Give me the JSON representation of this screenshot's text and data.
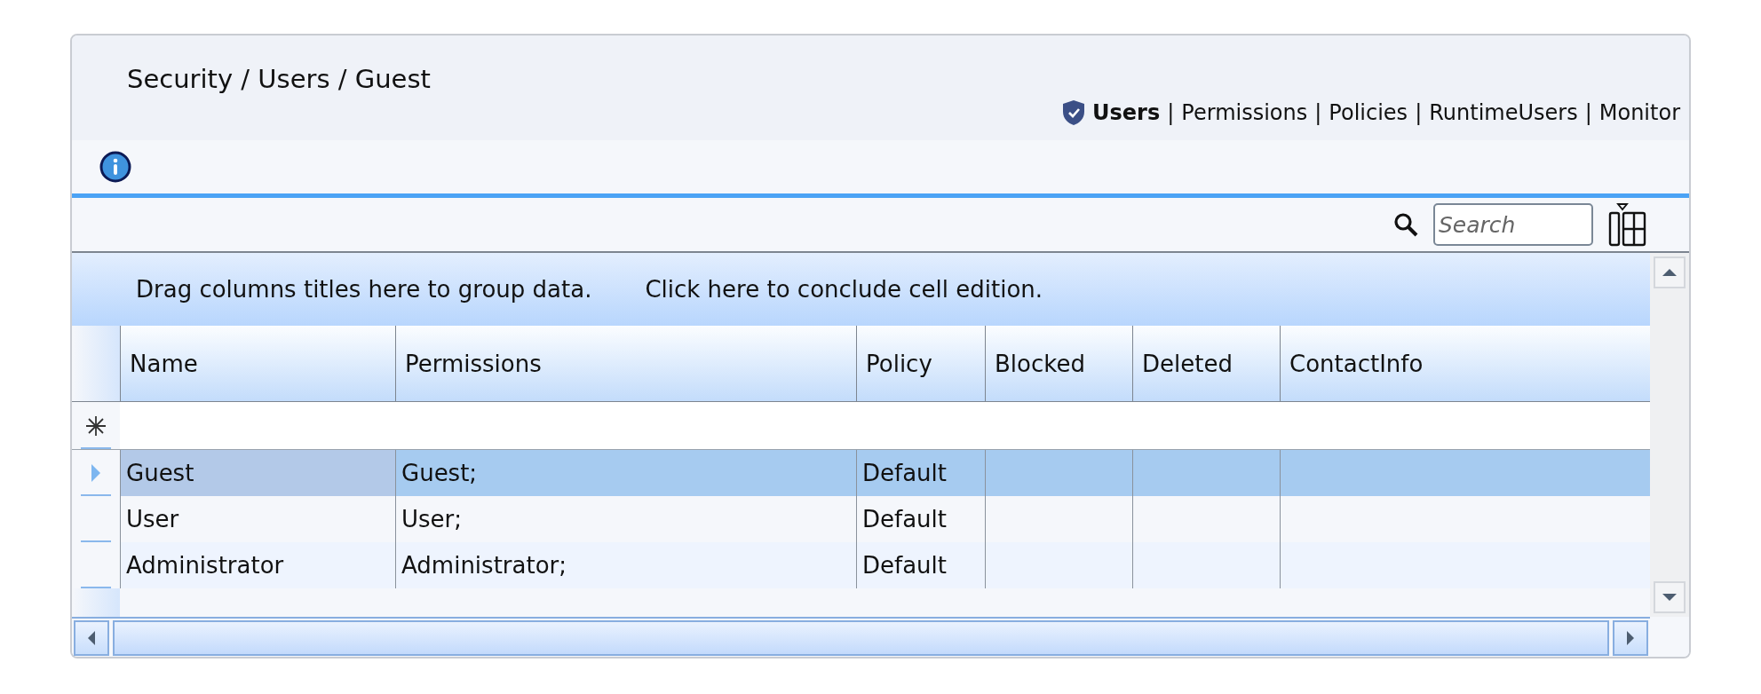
{
  "breadcrumb": "Security / Users / Guest",
  "nav": [
    {
      "kind": "link",
      "label": "Users",
      "selected": true
    },
    {
      "kind": "separator",
      "label": "|"
    },
    {
      "kind": "link",
      "label": "Permissions",
      "selected": false
    },
    {
      "kind": "separator",
      "label": "|"
    },
    {
      "kind": "link",
      "label": "Policies",
      "selected": false
    },
    {
      "kind": "separator",
      "label": "|"
    },
    {
      "kind": "link",
      "label": "RuntimeUsers",
      "selected": false
    },
    {
      "kind": "separator",
      "label": "|"
    },
    {
      "kind": "link",
      "label": "Monitor",
      "selected": false
    }
  ],
  "search": {
    "placeholder": "Search"
  },
  "grid": {
    "group_panel_hint": "Drag columns titles here to group data.",
    "edit_hint": "Click here to conclude cell edition.",
    "columns": [
      "Name",
      "Permissions",
      "Policy",
      "Blocked",
      "Deleted",
      "ContactInfo"
    ],
    "rows": [
      {
        "selected": true,
        "cells": [
          "Guest",
          "Guest;",
          "Default"
        ]
      },
      {
        "selected": false,
        "cells": [
          "User",
          "User;",
          "Default"
        ]
      },
      {
        "selected": false,
        "cells": [
          "Administrator",
          "Administrator;",
          "Default"
        ]
      }
    ]
  }
}
